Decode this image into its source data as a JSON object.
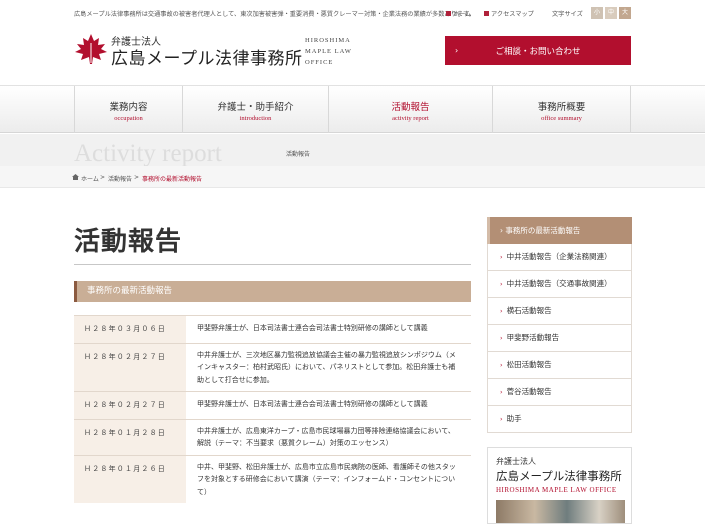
{
  "topbar": {
    "description": "広島メープル法律事務所は交通事故の被害者代理人として、東次加害被害弾・重要消費・悪質クレーマー対策・企業法務の業績が多数あります。",
    "home_label": "ホーム",
    "sitemap_label": "アクセスマップ",
    "font_size_label": "文字サイズ",
    "font_sizes": [
      "小",
      "中",
      "大"
    ]
  },
  "header": {
    "logo_sub": "弁護士法人",
    "logo_main": "広島メープル法律事務所",
    "logo_en": [
      "HIROSHIMA",
      "MAPLE LAW",
      "OFFICE"
    ],
    "consult_label": "ご相談・お問い合わせ",
    "consult_arrow": "›"
  },
  "nav": [
    {
      "jp": "業務内容",
      "en": "occupation"
    },
    {
      "jp": "弁護士・助手紹介",
      "en": "introduction"
    },
    {
      "jp": "活動報告",
      "en": "activity report"
    },
    {
      "jp": "事務所概要",
      "en": "office summary"
    }
  ],
  "pageband": {
    "big": "Activity report",
    "small": "活動報告"
  },
  "breadcrumb": {
    "home": "ホーム",
    "sep": ">",
    "parent": "活動報告",
    "current": "事務所の最新活動報告"
  },
  "main": {
    "title": "活動報告",
    "section_heading": "事務所の最新活動報告"
  },
  "news": [
    {
      "date": "Ｈ２８年０３月０６日",
      "text": "甲斐野弁護士が、日本司法書士連合会司法書士特別研修の講師として講義"
    },
    {
      "date": "Ｈ２８年０２月２７日",
      "text": "中井弁護士が、三次地区暴力監視追放協議会主催の暴力監視追放シンポジウム（メインキャスター：柏村武昭氏）において、パネリストとして参加。松田弁護士も補助として打合せに参加。"
    },
    {
      "date": "Ｈ２８年０２月２７日",
      "text": "甲斐野弁護士が、日本司法書士連合会司法書士特別研修の講師として講義"
    },
    {
      "date": "Ｈ２８年０１月２８日",
      "text": "中井弁護士が、広島東洋カープ・広島市民球場暴力団等排除連絡協議会において、解説（テーマ：不当要求（悪質クレーム）対策のエッセンス）"
    },
    {
      "date": "Ｈ２８年０１月２６日",
      "text": "中井、甲斐野、松田弁護士が、広島市立広島市民病院の医師、看護師その他スタッフを対象とする研修会において講演（テーマ：インフォームド・コンセントについて）"
    }
  ],
  "sidebar": {
    "current": "事務所の最新活動報告",
    "arrow": "›",
    "items": [
      "中井活動報告（企業法務関連）",
      "中井活動報告（交通事故関連）",
      "横石活動報告",
      "甲斐野活動報告",
      "松田活動報告",
      "菅谷活動報告",
      "助手"
    ]
  },
  "side_card": {
    "sub": "弁護士法人",
    "main": "広島メープル法律事務所",
    "en": "HIROSHIMA MAPLE LAW OFFICE"
  },
  "colors": {
    "accent": "#b20f2e",
    "section_bg": "#c9ae96",
    "sidebar_current": "#b38f75",
    "date_bg": "#f7efe7"
  }
}
